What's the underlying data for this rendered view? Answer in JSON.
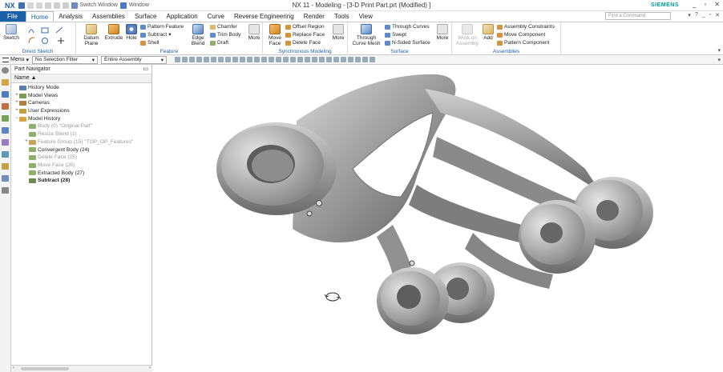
{
  "app": {
    "logo": "NX",
    "window_title": "NX 11 - Modeling - [3-D Print Part.prt (Modified) ]",
    "brand": "SIEMENS",
    "switch_window": "Switch Window",
    "window_menu": "Window",
    "find_command_placeholder": "Find a Command"
  },
  "menu": {
    "file": "File",
    "tabs": [
      "Home",
      "Analysis",
      "Assemblies",
      "Surface",
      "Application",
      "Curve",
      "Reverse Engineering",
      "Render",
      "Tools",
      "View"
    ]
  },
  "ribbon": {
    "direct_sketch": {
      "label": "Direct Sketch",
      "sketch": "Sketch"
    },
    "feature": {
      "label": "Feature",
      "datum_plane": "Datum Plane",
      "extrude": "Extrude",
      "hole": "Hole",
      "pattern_feature": "Pattern Feature",
      "subtract": "Subtract",
      "shell": "Shell",
      "edge_blend": "Edge Blend",
      "chamfer": "Chamfer",
      "trim_body": "Trim Body",
      "draft": "Draft",
      "more": "More"
    },
    "sync": {
      "label": "Synchronous Modeling",
      "move_face": "Move Face",
      "offset_region": "Offset Region",
      "replace_face": "Replace Face",
      "delete_face": "Delete Face",
      "more": "More"
    },
    "surface": {
      "label": "Surface",
      "through_curve_mesh": "Through Curve Mesh",
      "through_curves": "Through Curves",
      "swept": "Swept",
      "n_sided": "N-Sided Surface",
      "more": "More"
    },
    "assemblies": {
      "label": "Assemblies",
      "work_on_assembly": "Work on Assembly",
      "add": "Add",
      "assembly_constraints": "Assembly Constraints",
      "move_component": "Move Component",
      "pattern_component": "Pattern Component"
    }
  },
  "toolbar2": {
    "menu": "Menu",
    "selection_filter": "No Selection Filter",
    "scope": "Entire Assembly"
  },
  "navigator": {
    "title": "Part Navigator",
    "column": "Name",
    "nodes": [
      {
        "label": "History Mode",
        "expander": "",
        "indent": 0,
        "style": "normal",
        "icon": "#5a7fb0"
      },
      {
        "label": "Model Views",
        "expander": "+",
        "indent": 0,
        "style": "normal",
        "icon": "#7a9a5a"
      },
      {
        "label": "Cameras",
        "expander": "+",
        "indent": 0,
        "style": "normal",
        "icon": "#b08040"
      },
      {
        "label": "User Expressions",
        "expander": "+",
        "indent": 0,
        "style": "normal",
        "icon": "#c0a040"
      },
      {
        "label": "Model History",
        "expander": "−",
        "indent": 0,
        "style": "normal",
        "icon": "#d4a640"
      },
      {
        "label": "Body (0) \"Original Part\"",
        "expander": "",
        "indent": 1,
        "style": "dim",
        "icon": "#8fb06a"
      },
      {
        "label": "Resize Blend (1)",
        "expander": "",
        "indent": 1,
        "style": "dim",
        "icon": "#8fb06a"
      },
      {
        "label": "Feature Group (15) \"TOP_OP_Features\"",
        "expander": "+",
        "indent": 1,
        "style": "dim",
        "icon": "#c9a35a"
      },
      {
        "label": "Convergent Body (24)",
        "expander": "",
        "indent": 1,
        "style": "normal",
        "icon": "#8fb06a"
      },
      {
        "label": "Delete Face (25)",
        "expander": "",
        "indent": 1,
        "style": "dim",
        "icon": "#8fb06a"
      },
      {
        "label": "Move Face (26)",
        "expander": "",
        "indent": 1,
        "style": "dim",
        "icon": "#8fb06a"
      },
      {
        "label": "Extracted Body (27)",
        "expander": "",
        "indent": 1,
        "style": "normal",
        "icon": "#8fb06a"
      },
      {
        "label": "Subtract (28)",
        "expander": "",
        "indent": 1,
        "style": "bold",
        "icon": "#6d8b50"
      }
    ]
  },
  "colors": {
    "accent": "#1a5fa8",
    "brand": "#009999",
    "ribbon_group_label": "#1a5fa8"
  }
}
